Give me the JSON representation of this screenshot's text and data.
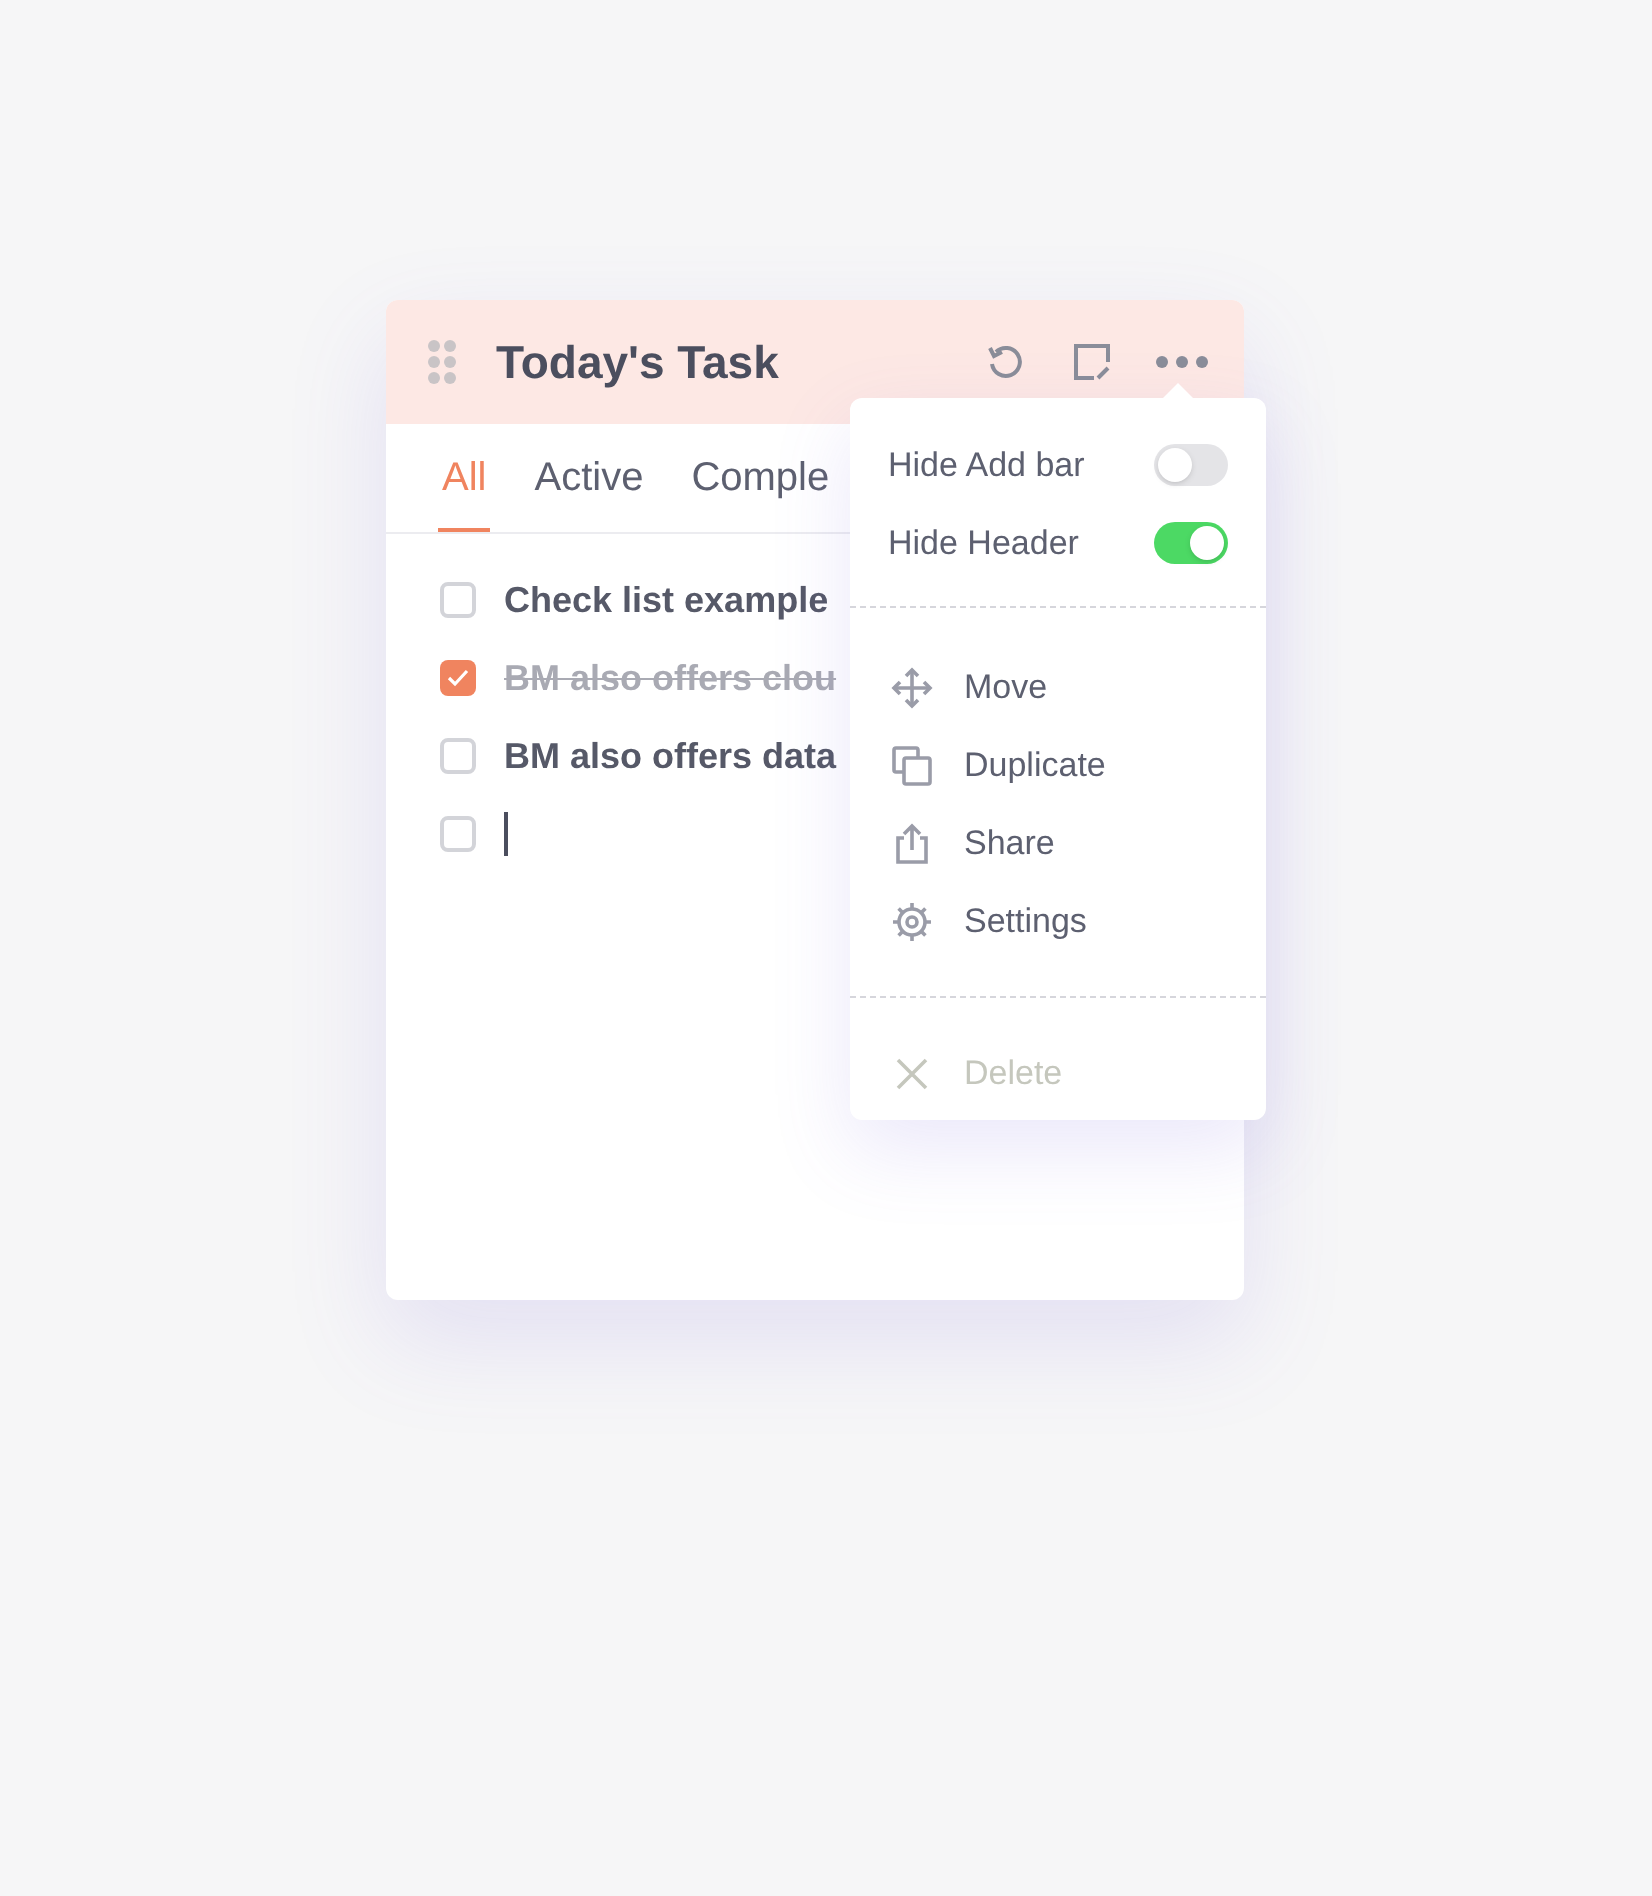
{
  "card": {
    "title": "Today's Task"
  },
  "tabs": [
    {
      "label": "All",
      "selected": true
    },
    {
      "label": "Active",
      "selected": false
    },
    {
      "label": "Comple",
      "selected": false
    }
  ],
  "tasks": [
    {
      "kind": "task",
      "text": "Check list example",
      "checked": false
    },
    {
      "kind": "task",
      "text": "BM also offers clou",
      "checked": true
    },
    {
      "kind": "task",
      "text": "BM also offers data",
      "checked": false
    },
    {
      "kind": "input",
      "checked": false
    }
  ],
  "menu": {
    "sections": [
      [
        {
          "kind": "toggle",
          "label": "Hide Add bar",
          "on": false
        },
        {
          "kind": "toggle",
          "label": "Hide Header",
          "on": true
        }
      ],
      [
        {
          "kind": "move",
          "label": "Move",
          "disabled": false
        },
        {
          "kind": "duplicate",
          "label": "Duplicate",
          "disabled": false
        },
        {
          "kind": "share",
          "label": "Share",
          "disabled": false
        },
        {
          "kind": "settings",
          "label": "Settings",
          "disabled": false
        }
      ],
      [
        {
          "kind": "delete",
          "label": "Delete",
          "disabled": true
        }
      ]
    ]
  }
}
